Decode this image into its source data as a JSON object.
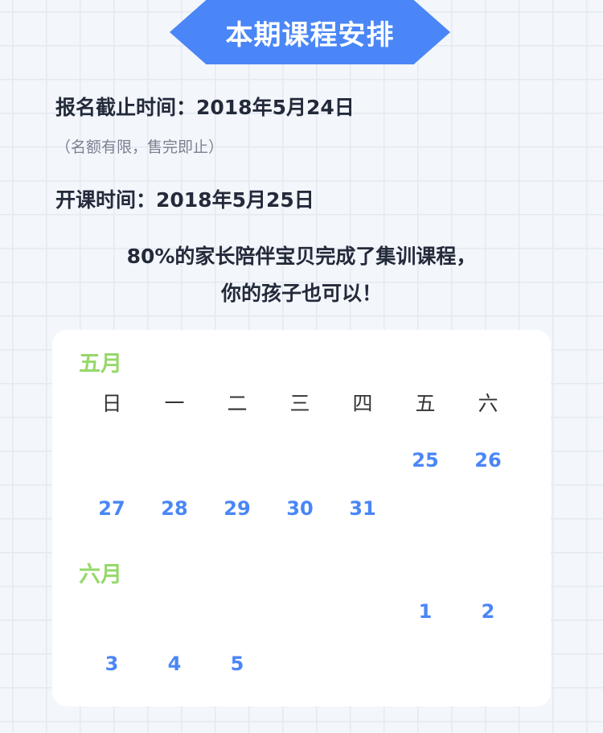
{
  "banner": {
    "title": "本期课程安排"
  },
  "info": {
    "deadline": "报名截止时间：2018年5月24日",
    "note": "（名额有限，售完即止）",
    "start": "开课时间：2018年5月25日"
  },
  "slogan": {
    "line1": "80%的家长陪伴宝贝完成了集训课程，",
    "line2": "你的孩子也可以！"
  },
  "calendar": {
    "weekdays": [
      "日",
      "一",
      "二",
      "三",
      "四",
      "五",
      "六"
    ],
    "months": [
      {
        "label": "五月",
        "rows": [
          [
            "",
            "",
            "",
            "",
            "",
            "25",
            "26"
          ],
          [
            "27",
            "28",
            "29",
            "30",
            "31",
            "",
            ""
          ]
        ]
      },
      {
        "label": "六月",
        "rows": [
          [
            "",
            "",
            "",
            "",
            "",
            "1",
            "2"
          ],
          [
            "3",
            "4",
            "5",
            "",
            "",
            "",
            ""
          ]
        ]
      }
    ],
    "colors": {
      "date": "#4a86f7",
      "month": "#96d86a",
      "banner": "#4a86f7"
    }
  }
}
